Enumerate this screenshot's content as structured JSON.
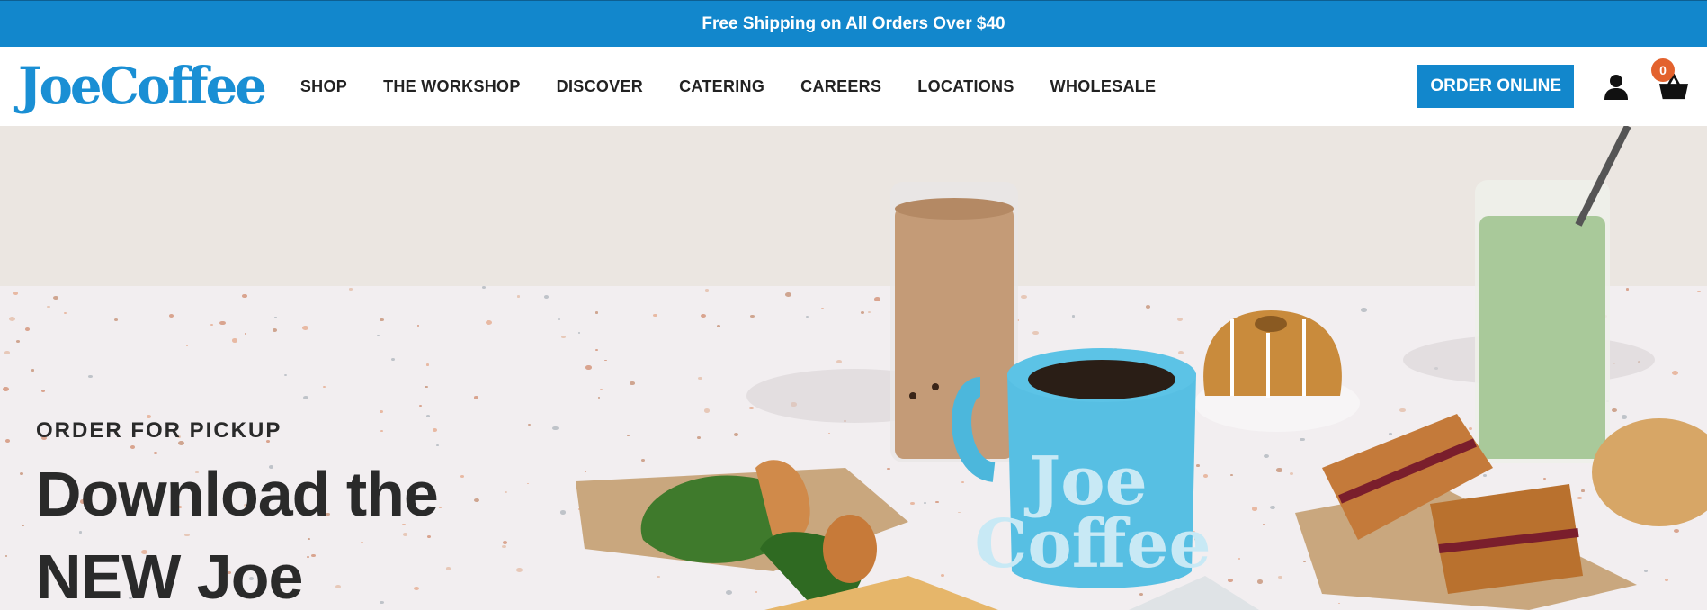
{
  "announcement": {
    "text": "Free Shipping on All Orders Over $40"
  },
  "header": {
    "logo": "JoeCoffee",
    "nav": [
      "SHOP",
      "THE WORKSHOP",
      "DISCOVER",
      "CATERING",
      "CAREERS",
      "LOCATIONS",
      "WHOLESALE"
    ],
    "order_button": "ORDER ONLINE",
    "cart_count": "0",
    "icons": [
      "account-icon",
      "cart-icon"
    ]
  },
  "hero": {
    "kicker": "ORDER FOR PICKUP",
    "headline_line1": "Download the",
    "headline_line2": "NEW Joe",
    "mug_text": "Joe Coffee"
  },
  "colors": {
    "brand_blue": "#1287cc",
    "badge_orange": "#e3622d",
    "text_dark": "#2a2a2a"
  }
}
